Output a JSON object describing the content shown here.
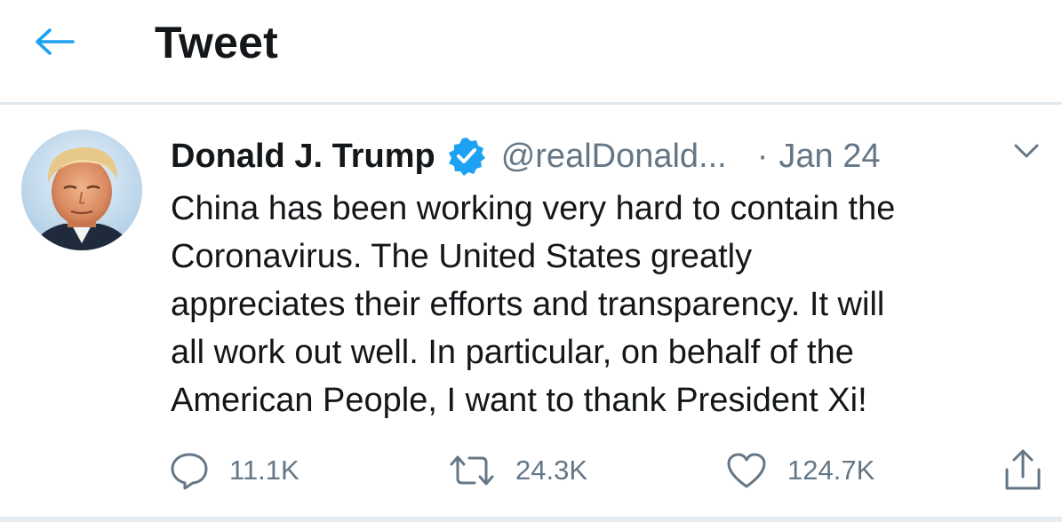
{
  "header": {
    "title": "Tweet",
    "back_icon": "arrow-left-icon"
  },
  "tweet": {
    "author": {
      "name": "Donald J. Trump",
      "handle": "@realDonald...",
      "verified": true,
      "avatar_icon": "profile-photo"
    },
    "separator": "·",
    "date": "Jan 24",
    "text_lines": [
      "China has been working very hard to contain the",
      "Coronavirus. The United States greatly",
      "appreciates their efforts and transparency. It will",
      "all work out well. In particular, on behalf of the",
      "American People, I want to thank President Xi!"
    ],
    "actions": {
      "reply_count": "11.1K",
      "retweet_count": "24.3K",
      "like_count": "124.7K"
    }
  },
  "colors": {
    "accent": "#1da1f2",
    "text": "#14171a",
    "secondary_text": "#657786",
    "divider": "#e1e8ed"
  }
}
